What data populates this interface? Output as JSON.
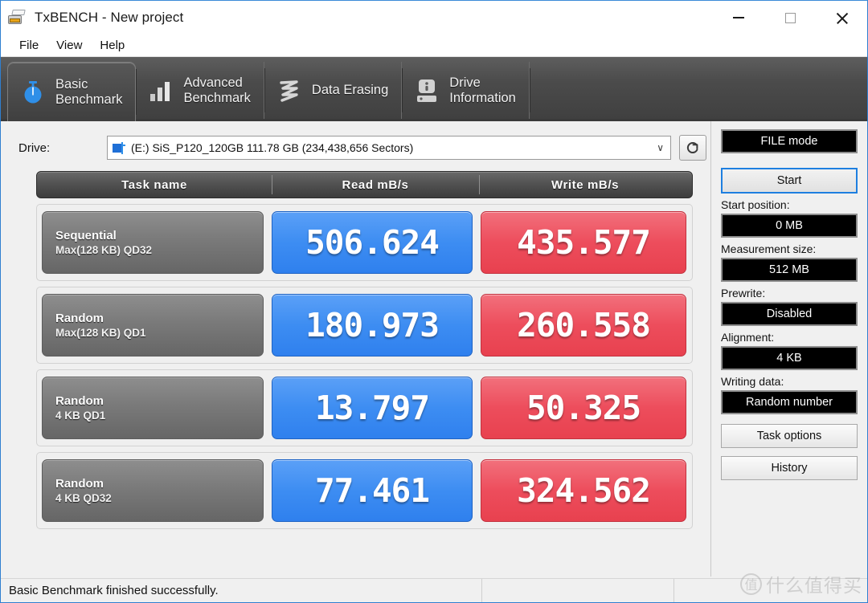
{
  "window": {
    "title": "TxBENCH - New project",
    "icon": "printer-icon",
    "controls": {
      "minimize": "minimize-icon",
      "maximize": "maximize-icon",
      "close": "close-icon"
    }
  },
  "menu": {
    "items": [
      {
        "label": "File"
      },
      {
        "label": "View"
      },
      {
        "label": "Help"
      }
    ]
  },
  "tabs": [
    {
      "label": "Basic\nBenchmark",
      "icon": "stopwatch-icon",
      "active": true
    },
    {
      "label": "Advanced\nBenchmark",
      "icon": "bar-chart-icon",
      "active": false
    },
    {
      "label": "Data Erasing",
      "icon": "scribble-icon",
      "active": false
    },
    {
      "label": "Drive\nInformation",
      "icon": "hard-drive-icon",
      "active": false
    }
  ],
  "drive": {
    "label": "Drive:",
    "selected": "(E:) SiS_P120_120GB  111.78 GB (234,438,656 Sectors)",
    "caret": "∨",
    "refresh_icon": "refresh-icon"
  },
  "table": {
    "headers": {
      "task": "Task name",
      "read": "Read mB/s",
      "write": "Write mB/s"
    },
    "rows": [
      {
        "name_line1": "Sequential",
        "name_line2": "Max(128 KB) QD32",
        "read": "506.624",
        "write": "435.577"
      },
      {
        "name_line1": "Random",
        "name_line2": "Max(128 KB) QD1",
        "read": "180.973",
        "write": "260.558"
      },
      {
        "name_line1": "Random",
        "name_line2": "4 KB QD1",
        "read": "13.797",
        "write": "50.325"
      },
      {
        "name_line1": "Random",
        "name_line2": "4 KB QD32",
        "read": "77.461",
        "write": "324.562"
      }
    ]
  },
  "sidebar": {
    "mode_value": "FILE mode",
    "start_label": "Start",
    "start_position_label": "Start position:",
    "start_position_value": "0 MB",
    "measurement_size_label": "Measurement size:",
    "measurement_size_value": "512 MB",
    "prewrite_label": "Prewrite:",
    "prewrite_value": "Disabled",
    "alignment_label": "Alignment:",
    "alignment_value": "4 KB",
    "writing_data_label": "Writing data:",
    "writing_data_value": "Random number",
    "task_options_label": "Task options",
    "history_label": "History"
  },
  "status": {
    "message": "Basic Benchmark finished successfully."
  },
  "watermark": {
    "mark": "值",
    "text": "什么值得买"
  },
  "colors": {
    "read_blue": "#3d8df2",
    "write_red": "#ed4d5c",
    "tab_dark": "#4b4b4b",
    "accent_border": "#1e7fe0"
  }
}
